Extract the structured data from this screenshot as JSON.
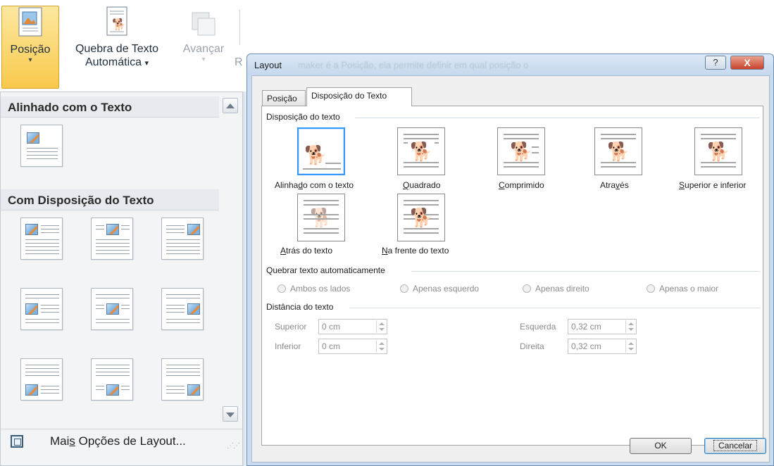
{
  "ribbon": {
    "position_label": "Posição",
    "wrap_label_line1": "Quebra de Texto",
    "wrap_label_line2": "Automática",
    "advance_label": "Avançar",
    "cut_label": "R",
    "dropdown_arrow": "▾",
    "menu_arrow": "▾"
  },
  "gallery": {
    "section_inline": "Alinhado com o Texto",
    "section_wrap": "Com Disposição do Texto",
    "more_options_pre": "Mai",
    "more_options_accel": "s",
    "more_options_post": " Opções de Layout..."
  },
  "dialog": {
    "title": "Layout",
    "background_text": "maker é a Posição, ela permite definir em qual posição o",
    "help_label": "?",
    "close_label": "X",
    "tabs": [
      "Posição",
      "Disposição do Texto"
    ],
    "wrap_group_label": "Disposição do texto",
    "wrap_options": [
      {
        "pre": "Alinha",
        "accel": "d",
        "post": "o com o texto"
      },
      {
        "pre": "",
        "accel": "Q",
        "post": "uadrado"
      },
      {
        "pre": "",
        "accel": "C",
        "post": "omprimido"
      },
      {
        "pre": "Atra",
        "accel": "v",
        "post": "és"
      },
      {
        "pre": "",
        "accel": "S",
        "post": "uperior e inferior"
      },
      {
        "pre": "",
        "accel": "A",
        "post": "trás do texto"
      },
      {
        "pre": "",
        "accel": "N",
        "post": "a frente do texto"
      }
    ],
    "break_group_label": "Quebrar texto automaticamente",
    "break_options": [
      "Ambos os lados",
      "Apenas esquerdo",
      "Apenas direito",
      "Apenas o maior"
    ],
    "distance_group_label": "Distância do texto",
    "distance": {
      "top_label": "Superior",
      "top_value": "0 cm",
      "bottom_label": "Inferior",
      "bottom_value": "0 cm",
      "left_label": "Esquerda",
      "left_value": "0,32 cm",
      "right_label": "Direita",
      "right_value": "0,32 cm"
    },
    "ok_label": "OK",
    "cancel_label": "Cancelar"
  },
  "icons": {
    "dog_glyph": "🐕",
    "grip": "⋰⋰"
  }
}
